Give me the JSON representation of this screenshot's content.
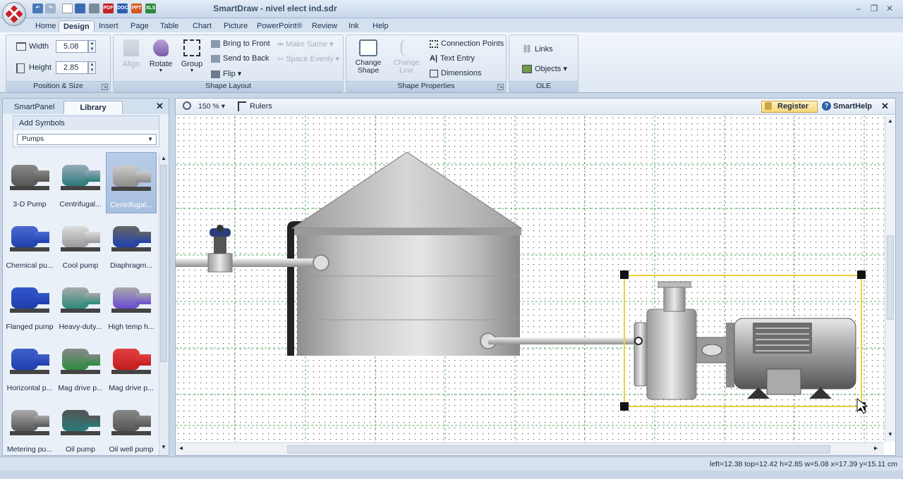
{
  "window": {
    "title": "SmartDraw - nivel elect ind.sdr"
  },
  "menu": {
    "tabs": [
      "Home",
      "Design",
      "Insert",
      "Page",
      "Table",
      "Chart",
      "Picture",
      "PowerPoint®",
      "Review",
      "Ink",
      "Help"
    ],
    "active": "Design"
  },
  "ribbon": {
    "position_size": {
      "title": "Position & Size",
      "width_label": "Width",
      "width_value": "5.08",
      "height_label": "Height",
      "height_value": "2.85"
    },
    "shape_layout": {
      "title": "Shape Layout",
      "align": "Align",
      "rotate": "Rotate",
      "group": "Group",
      "bring_front": "Bring to Front",
      "send_back": "Send to Back",
      "flip": "Flip",
      "make_same": "Make Same",
      "space_evenly": "Space Evenly"
    },
    "shape_properties": {
      "title": "Shape Properties",
      "change_shape": "Change Shape",
      "change_line": "Change Line",
      "connection_points": "Connection Points",
      "text_entry": "Text Entry",
      "dimensions": "Dimensions"
    },
    "ole": {
      "title": "OLE",
      "links": "Links",
      "objects": "Objects"
    }
  },
  "panel": {
    "tabs": [
      "SmartPanel",
      "Library"
    ],
    "active_tab": "Library",
    "add_symbols": "Add Symbols",
    "category": "Pumps",
    "symbols": [
      "3-D Pump",
      "Centrifugal...",
      "Centrifugal...",
      "Chemical pu...",
      "Cool pump",
      "Diaphragm...",
      "Flanged pump",
      "Heavy-duty...",
      "High temp h...",
      "Horizontal p...",
      "Mag drive p...",
      "Mag drive p...",
      "Metering pu...",
      "Oil pump",
      "Oil well pump"
    ],
    "selected_index": 2
  },
  "canvas": {
    "zoom": "150 %",
    "rulers": "Rulers",
    "register": "Register",
    "smarthelp": "SmartHelp"
  },
  "status": {
    "text": "left=12.38 top=12.42 h=2.85 w=5.08   x=17.39 y=15.11 cm"
  },
  "colors": {
    "accent": "#c8202a",
    "selection": "#f0d040",
    "grid": "#2e9e3e"
  }
}
